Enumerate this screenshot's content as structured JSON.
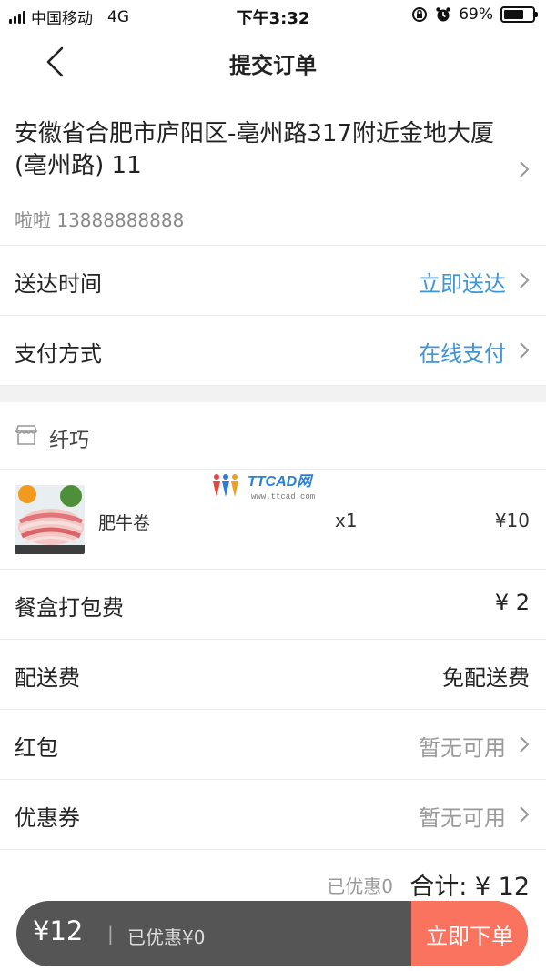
{
  "status_bar": {
    "carrier": "中国移动",
    "network": "4G",
    "time": "下午3:32",
    "battery": "69%",
    "battery_level": 0.69
  },
  "nav": {
    "title": "提交订单"
  },
  "address": {
    "text": "安徽省合肥市庐阳区-亳州路317附近金地大厦(亳州路) 11",
    "contact": "啦啦 13888888888"
  },
  "delivery_time": {
    "label": "送达时间",
    "value": "立即送达"
  },
  "payment": {
    "label": "支付方式",
    "value": "在线支付"
  },
  "shop": {
    "name": "纤巧"
  },
  "watermark": {
    "brand": "TTCAD网",
    "url": "www.ttcad.com"
  },
  "item": {
    "name": "肥牛卷",
    "qty": "x1",
    "price": "¥10"
  },
  "packing_fee": {
    "label": "餐盒打包费",
    "value": "¥ 2"
  },
  "delivery_fee": {
    "label": "配送费",
    "value": "免配送费"
  },
  "red_packet": {
    "label": "红包",
    "value": "暂无可用"
  },
  "coupon": {
    "label": "优惠券",
    "value": "暂无可用"
  },
  "summary": {
    "discount": "已优惠0",
    "total": "合计: ¥ 12"
  },
  "bottom_bar": {
    "price": "¥12",
    "separator": "|",
    "discount": "已优惠¥0",
    "submit": "立即下单"
  },
  "colors": {
    "accent_blue": "#3e95d8",
    "submit_orange": "#f9735f",
    "bar_dark": "#555555"
  }
}
